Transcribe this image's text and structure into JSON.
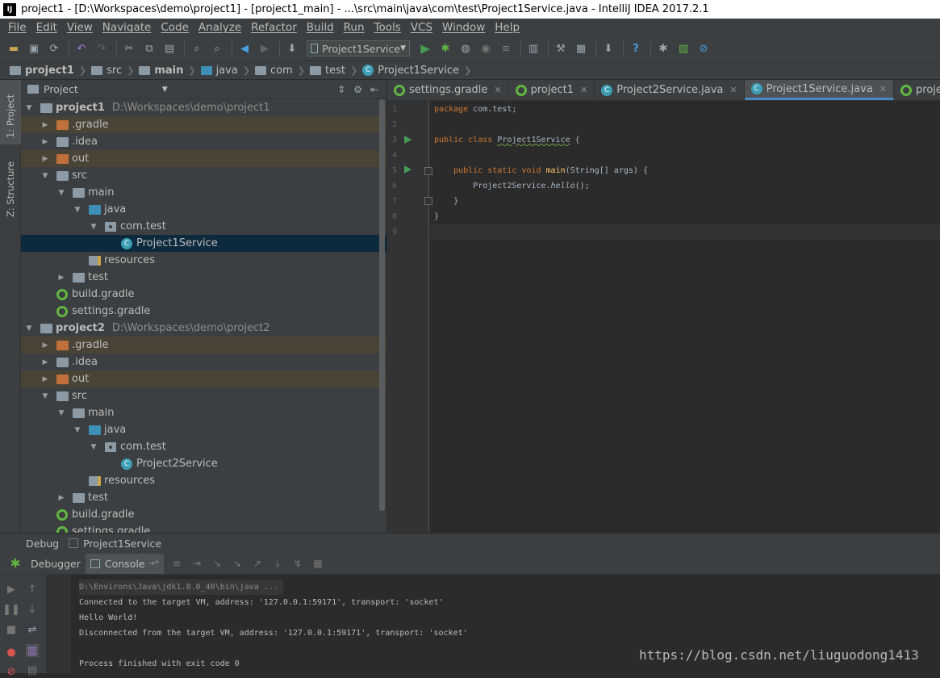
{
  "window": {
    "title": "project1 - [D:\\Workspaces\\demo\\project1] - [project1_main] - ...\\src\\main\\java\\com\\test\\Project1Service.java - IntelliJ IDEA 2017.2.1",
    "app_icon": "IJ"
  },
  "menu": [
    "File",
    "Edit",
    "View",
    "Navigate",
    "Code",
    "Analyze",
    "Refactor",
    "Build",
    "Run",
    "Tools",
    "VCS",
    "Window",
    "Help"
  ],
  "toolbar": {
    "run_config": "Project1Service"
  },
  "breadcrumb": [
    "project1",
    "src",
    "main",
    "java",
    "com",
    "test",
    "Project1Service"
  ],
  "left_stripe": {
    "project_tab": "1: Project",
    "structure_tab": "Z: Structure"
  },
  "project_panel": {
    "title": "Project",
    "tree": [
      {
        "label": "project1",
        "path": "D:\\Workspaces\\demo\\project1"
      },
      {
        "label": ".gradle"
      },
      {
        "label": ".idea"
      },
      {
        "label": "out"
      },
      {
        "label": "src"
      },
      {
        "label": "main"
      },
      {
        "label": "java"
      },
      {
        "label": "com.test"
      },
      {
        "label": "Project1Service"
      },
      {
        "label": "resources"
      },
      {
        "label": "test"
      },
      {
        "label": "build.gradle"
      },
      {
        "label": "settings.gradle"
      },
      {
        "label": "project2",
        "path": "D:\\Workspaces\\demo\\project2"
      },
      {
        "label": ".gradle"
      },
      {
        "label": ".idea"
      },
      {
        "label": "out"
      },
      {
        "label": "src"
      },
      {
        "label": "main"
      },
      {
        "label": "java"
      },
      {
        "label": "com.test"
      },
      {
        "label": "Project2Service"
      },
      {
        "label": "resources"
      },
      {
        "label": "test"
      },
      {
        "label": "build.gradle"
      },
      {
        "label": "settings.gradle"
      }
    ]
  },
  "editor_tabs": [
    "settings.gradle",
    "project1",
    "Project2Service.java",
    "Project1Service.java",
    "project2"
  ],
  "editor": {
    "line_numbers": [
      "1",
      "2",
      "3",
      "4",
      "5",
      "6",
      "7",
      "8",
      "9"
    ],
    "code": {
      "l1_kw": "package",
      "l1_rest": " com.test;",
      "l3_kw1": "public",
      "l3_kw2": "class",
      "l3_cls": "Project1Service",
      "l3_rest": " {",
      "l5_kw1": "public",
      "l5_kw2": "static",
      "l5_kw3": "void",
      "l5_fn": "main",
      "l5_rest": "(String[] args) {",
      "l6_obj": "Project2Service.",
      "l6_call": "hello",
      "l6_rest": "();",
      "l7": "}",
      "l8": "}"
    }
  },
  "debug": {
    "header_label": "Debug",
    "header_config": "Project1Service",
    "tab_debugger": "Debugger",
    "tab_console": "Console",
    "console_lines": [
      "D:\\Environs\\Java\\jdk1.8.0_40\\bin\\java ...",
      "Connected to the target VM, address: '127.0.0.1:59171', transport: 'socket'",
      "Hello World!",
      "Disconnected from the target VM, address: '127.0.0.1:59171', transport: 'socket'",
      "",
      "Process finished with exit code 0"
    ]
  },
  "watermark": "https://blog.csdn.net/liuguodong1413"
}
